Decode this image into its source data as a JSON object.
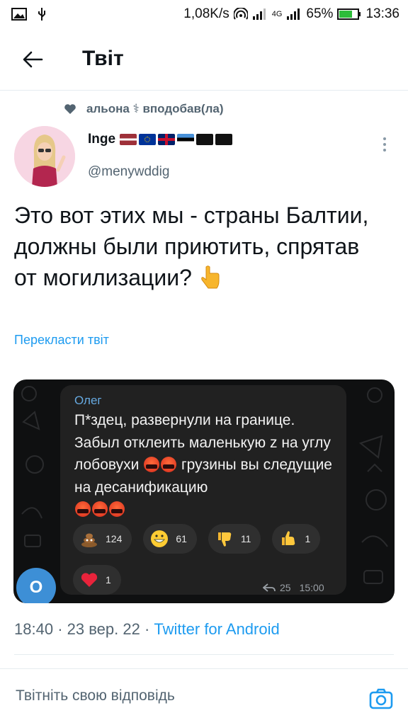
{
  "status_bar": {
    "speed": "1,08K/s",
    "network": "4G",
    "battery": "65%",
    "time": "13:36"
  },
  "header": {
    "title": "Твіт"
  },
  "social_context": {
    "text": "альона ⚕ вподобав(ла)"
  },
  "author": {
    "name": "Inge",
    "handle": "@menywddig"
  },
  "tweet": {
    "text": "Это вот этих мы - страны Балтии, должны были приютить, спрятав от могилизации?",
    "translate_label": "Перекласти твіт"
  },
  "media": {
    "chat": {
      "avatar_letter": "О",
      "sender": "Олег",
      "line1": "П*здец, развернули на границе. Забыл отклеить маленькую z на углу лобовухи",
      "line2": "грузины вы следущие на деcанификацию",
      "reactions": [
        {
          "icon": "poop-emoji",
          "count": "124"
        },
        {
          "icon": "grin-emoji",
          "count": "61"
        },
        {
          "icon": "thumbs-down-emoji",
          "count": "11"
        },
        {
          "icon": "thumbs-up-emoji",
          "count": "1"
        }
      ],
      "heart_reaction": {
        "icon": "heart-emoji",
        "count": "1"
      },
      "forwards": "25",
      "time": "15:00"
    }
  },
  "meta": {
    "time": "18:40",
    "date": "23 вер. 22",
    "source": "Twitter for Android"
  },
  "reply": {
    "placeholder": "Твітніть свою відповідь"
  },
  "colors": {
    "accent": "#1d9bf0",
    "text": "#0f1419",
    "secondary": "#536471"
  }
}
